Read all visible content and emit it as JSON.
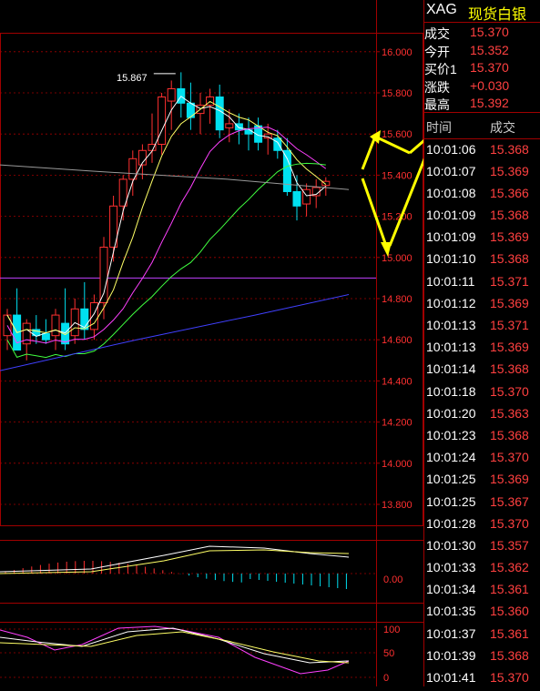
{
  "header": {
    "symbol": "XAG",
    "name": "现货白银"
  },
  "quote": [
    {
      "label": "成交",
      "value": "15.370"
    },
    {
      "label": "今开",
      "value": "15.352"
    },
    {
      "label": "买价1",
      "value": "15.370"
    },
    {
      "label": "涨跌",
      "value": "+0.030"
    },
    {
      "label": "最高",
      "value": "15.392"
    }
  ],
  "ticks_header": {
    "time": "时间",
    "price": "成交"
  },
  "ticks": [
    {
      "time": "10:01:06",
      "price": "15.368"
    },
    {
      "time": "10:01:07",
      "price": "15.369"
    },
    {
      "time": "10:01:08",
      "price": "15.366"
    },
    {
      "time": "10:01:09",
      "price": "15.368"
    },
    {
      "time": "10:01:09",
      "price": "15.369"
    },
    {
      "time": "10:01:10",
      "price": "15.368"
    },
    {
      "time": "10:01:11",
      "price": "15.371"
    },
    {
      "time": "10:01:12",
      "price": "15.369"
    },
    {
      "time": "10:01:13",
      "price": "15.371"
    },
    {
      "time": "10:01:13",
      "price": "15.369"
    },
    {
      "time": "10:01:14",
      "price": "15.368"
    },
    {
      "time": "10:01:18",
      "price": "15.370"
    },
    {
      "time": "10:01:20",
      "price": "15.363"
    },
    {
      "time": "10:01:23",
      "price": "15.368"
    },
    {
      "time": "10:01:24",
      "price": "15.370"
    },
    {
      "time": "10:01:25",
      "price": "15.369"
    },
    {
      "time": "10:01:25",
      "price": "15.367"
    },
    {
      "time": "10:01:28",
      "price": "15.370"
    },
    {
      "time": "10:01:30",
      "price": "15.357"
    },
    {
      "time": "10:01:33",
      "price": "15.362"
    },
    {
      "time": "10:01:34",
      "price": "15.361"
    },
    {
      "time": "10:01:35",
      "price": "15.360"
    },
    {
      "time": "10:01:37",
      "price": "15.361"
    },
    {
      "time": "10:01:39",
      "price": "15.368"
    },
    {
      "time": "10:01:41",
      "price": "15.370"
    }
  ],
  "price_axis": [
    "16.000",
    "15.800",
    "15.600",
    "15.400",
    "15.200",
    "15.000",
    "14.800",
    "14.600",
    "14.400",
    "14.200",
    "14.000",
    "13.800"
  ],
  "macd_axis": [
    "0.00"
  ],
  "kdj_axis": [
    "100",
    "50",
    "0"
  ],
  "annotation": {
    "high_marker": "15.867"
  },
  "colors": {
    "up": "#ff3030",
    "down": "#00e0f0",
    "grid": "#a00000",
    "axis_text": "#ff3030",
    "ma5": "#ffffff",
    "ma10": "#ffff66",
    "ma20": "#ff40ff",
    "ma30": "#40ff40",
    "ma60": "#4040ff",
    "hline": "#c040ff",
    "arrow": "#ffff00"
  },
  "chart_data": {
    "type": "candlestick",
    "ylim": [
      13.7,
      16.1
    ],
    "candles": [
      {
        "o": 14.62,
        "h": 14.75,
        "l": 14.55,
        "c": 14.72
      },
      {
        "o": 14.72,
        "h": 14.85,
        "l": 14.6,
        "c": 14.55
      },
      {
        "o": 14.58,
        "h": 14.7,
        "l": 14.5,
        "c": 14.68
      },
      {
        "o": 14.65,
        "h": 14.72,
        "l": 14.58,
        "c": 14.62
      },
      {
        "o": 14.63,
        "h": 14.7,
        "l": 14.58,
        "c": 14.6
      },
      {
        "o": 14.62,
        "h": 14.75,
        "l": 14.55,
        "c": 14.72
      },
      {
        "o": 14.68,
        "h": 14.85,
        "l": 14.55,
        "c": 14.58
      },
      {
        "o": 14.62,
        "h": 14.8,
        "l": 14.58,
        "c": 14.75
      },
      {
        "o": 14.75,
        "h": 14.88,
        "l": 14.6,
        "c": 14.65
      },
      {
        "o": 14.65,
        "h": 14.82,
        "l": 14.6,
        "c": 14.78
      },
      {
        "o": 14.78,
        "h": 15.1,
        "l": 14.7,
        "c": 15.05
      },
      {
        "o": 15.05,
        "h": 15.3,
        "l": 14.98,
        "c": 15.25
      },
      {
        "o": 15.25,
        "h": 15.4,
        "l": 15.18,
        "c": 15.38
      },
      {
        "o": 15.38,
        "h": 15.52,
        "l": 15.3,
        "c": 15.48
      },
      {
        "o": 15.45,
        "h": 15.55,
        "l": 15.38,
        "c": 15.52
      },
      {
        "o": 15.52,
        "h": 15.7,
        "l": 15.46,
        "c": 15.55
      },
      {
        "o": 15.55,
        "h": 15.8,
        "l": 15.5,
        "c": 15.78
      },
      {
        "o": 15.76,
        "h": 15.86,
        "l": 15.62,
        "c": 15.82
      },
      {
        "o": 15.82,
        "h": 15.9,
        "l": 15.68,
        "c": 15.75
      },
      {
        "o": 15.75,
        "h": 15.85,
        "l": 15.62,
        "c": 15.68
      },
      {
        "o": 15.7,
        "h": 15.8,
        "l": 15.6,
        "c": 15.74
      },
      {
        "o": 15.74,
        "h": 15.82,
        "l": 15.65,
        "c": 15.78
      },
      {
        "o": 15.78,
        "h": 15.84,
        "l": 15.58,
        "c": 15.62
      },
      {
        "o": 15.63,
        "h": 15.72,
        "l": 15.56,
        "c": 15.65
      },
      {
        "o": 15.65,
        "h": 15.7,
        "l": 15.55,
        "c": 15.62
      },
      {
        "o": 15.62,
        "h": 15.68,
        "l": 15.52,
        "c": 15.6
      },
      {
        "o": 15.64,
        "h": 15.68,
        "l": 15.52,
        "c": 15.56
      },
      {
        "o": 15.58,
        "h": 15.65,
        "l": 15.5,
        "c": 15.6
      },
      {
        "o": 15.58,
        "h": 15.62,
        "l": 15.48,
        "c": 15.52
      },
      {
        "o": 15.52,
        "h": 15.58,
        "l": 15.3,
        "c": 15.32
      },
      {
        "o": 15.32,
        "h": 15.4,
        "l": 15.18,
        "c": 15.25
      },
      {
        "o": 15.26,
        "h": 15.36,
        "l": 15.2,
        "c": 15.33
      },
      {
        "o": 15.3,
        "h": 15.38,
        "l": 15.24,
        "c": 15.34
      },
      {
        "o": 15.35,
        "h": 15.39,
        "l": 15.3,
        "c": 15.37
      }
    ]
  }
}
